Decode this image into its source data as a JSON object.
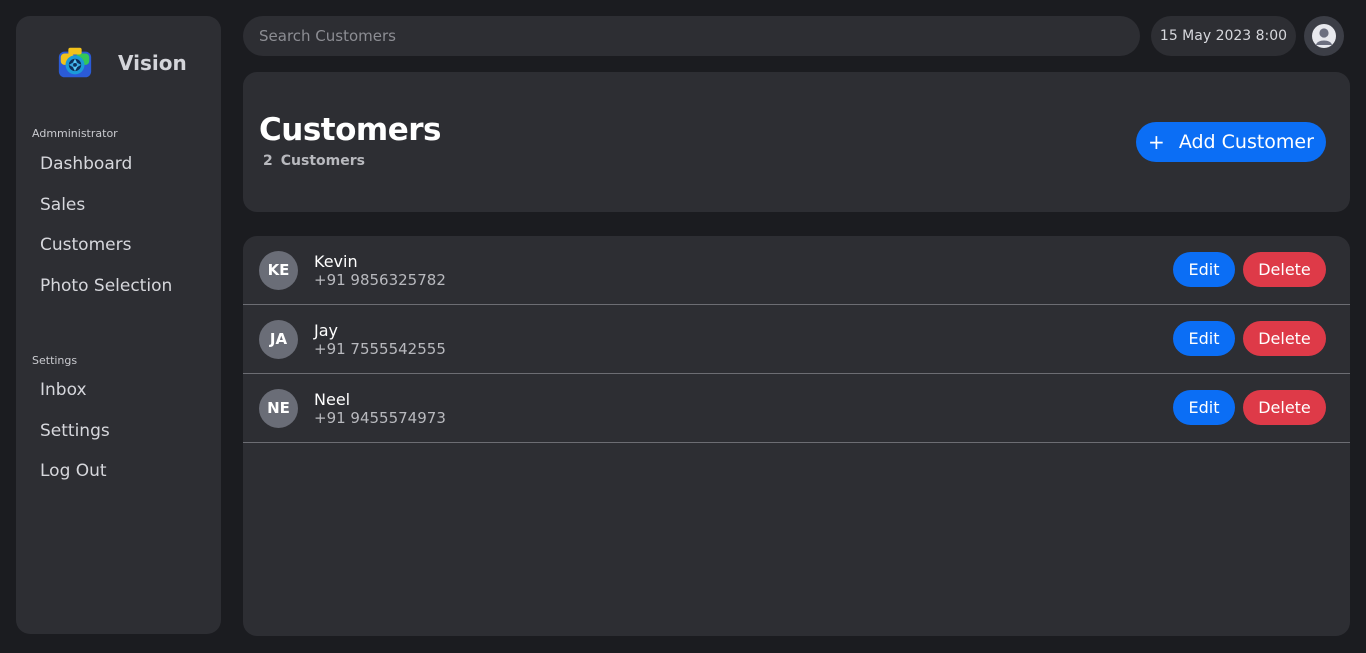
{
  "brand": {
    "name": "Vision"
  },
  "sidebar": {
    "admin_label": "Admministrator",
    "admin_items": [
      {
        "label": "Dashboard"
      },
      {
        "label": "Sales"
      },
      {
        "label": "Customers"
      },
      {
        "label": "Photo Selection"
      }
    ],
    "settings_label": "Settings",
    "settings_items": [
      {
        "label": "Inbox"
      },
      {
        "label": "Settings"
      },
      {
        "label": "Log Out"
      }
    ]
  },
  "topbar": {
    "search_placeholder": "Search Customers",
    "search_value": "",
    "datetime": "15 May 2023 8:00"
  },
  "header": {
    "title": "Customers",
    "count": "2",
    "count_label": "Customers",
    "add_button": {
      "icon": "+",
      "label": "Add Customer"
    }
  },
  "customers": [
    {
      "initials": "KE",
      "name": "Kevin",
      "phone": "+91 9856325782"
    },
    {
      "initials": "JA",
      "name": "Jay",
      "phone": "+91 7555542555"
    },
    {
      "initials": "NE",
      "name": "Neel",
      "phone": "+91 9455574973"
    }
  ],
  "row_actions": {
    "edit": "Edit",
    "delete": "Delete"
  },
  "colors": {
    "background": "#1b1c20",
    "card": "#2d2e33",
    "primary": "#0b6ef5",
    "danger": "#de3a48",
    "avatar": "#6a6d77"
  },
  "icons": {
    "logo": "camera-aperture-logo-icon",
    "profile": "user-avatar-icon",
    "add": "plus-icon"
  }
}
